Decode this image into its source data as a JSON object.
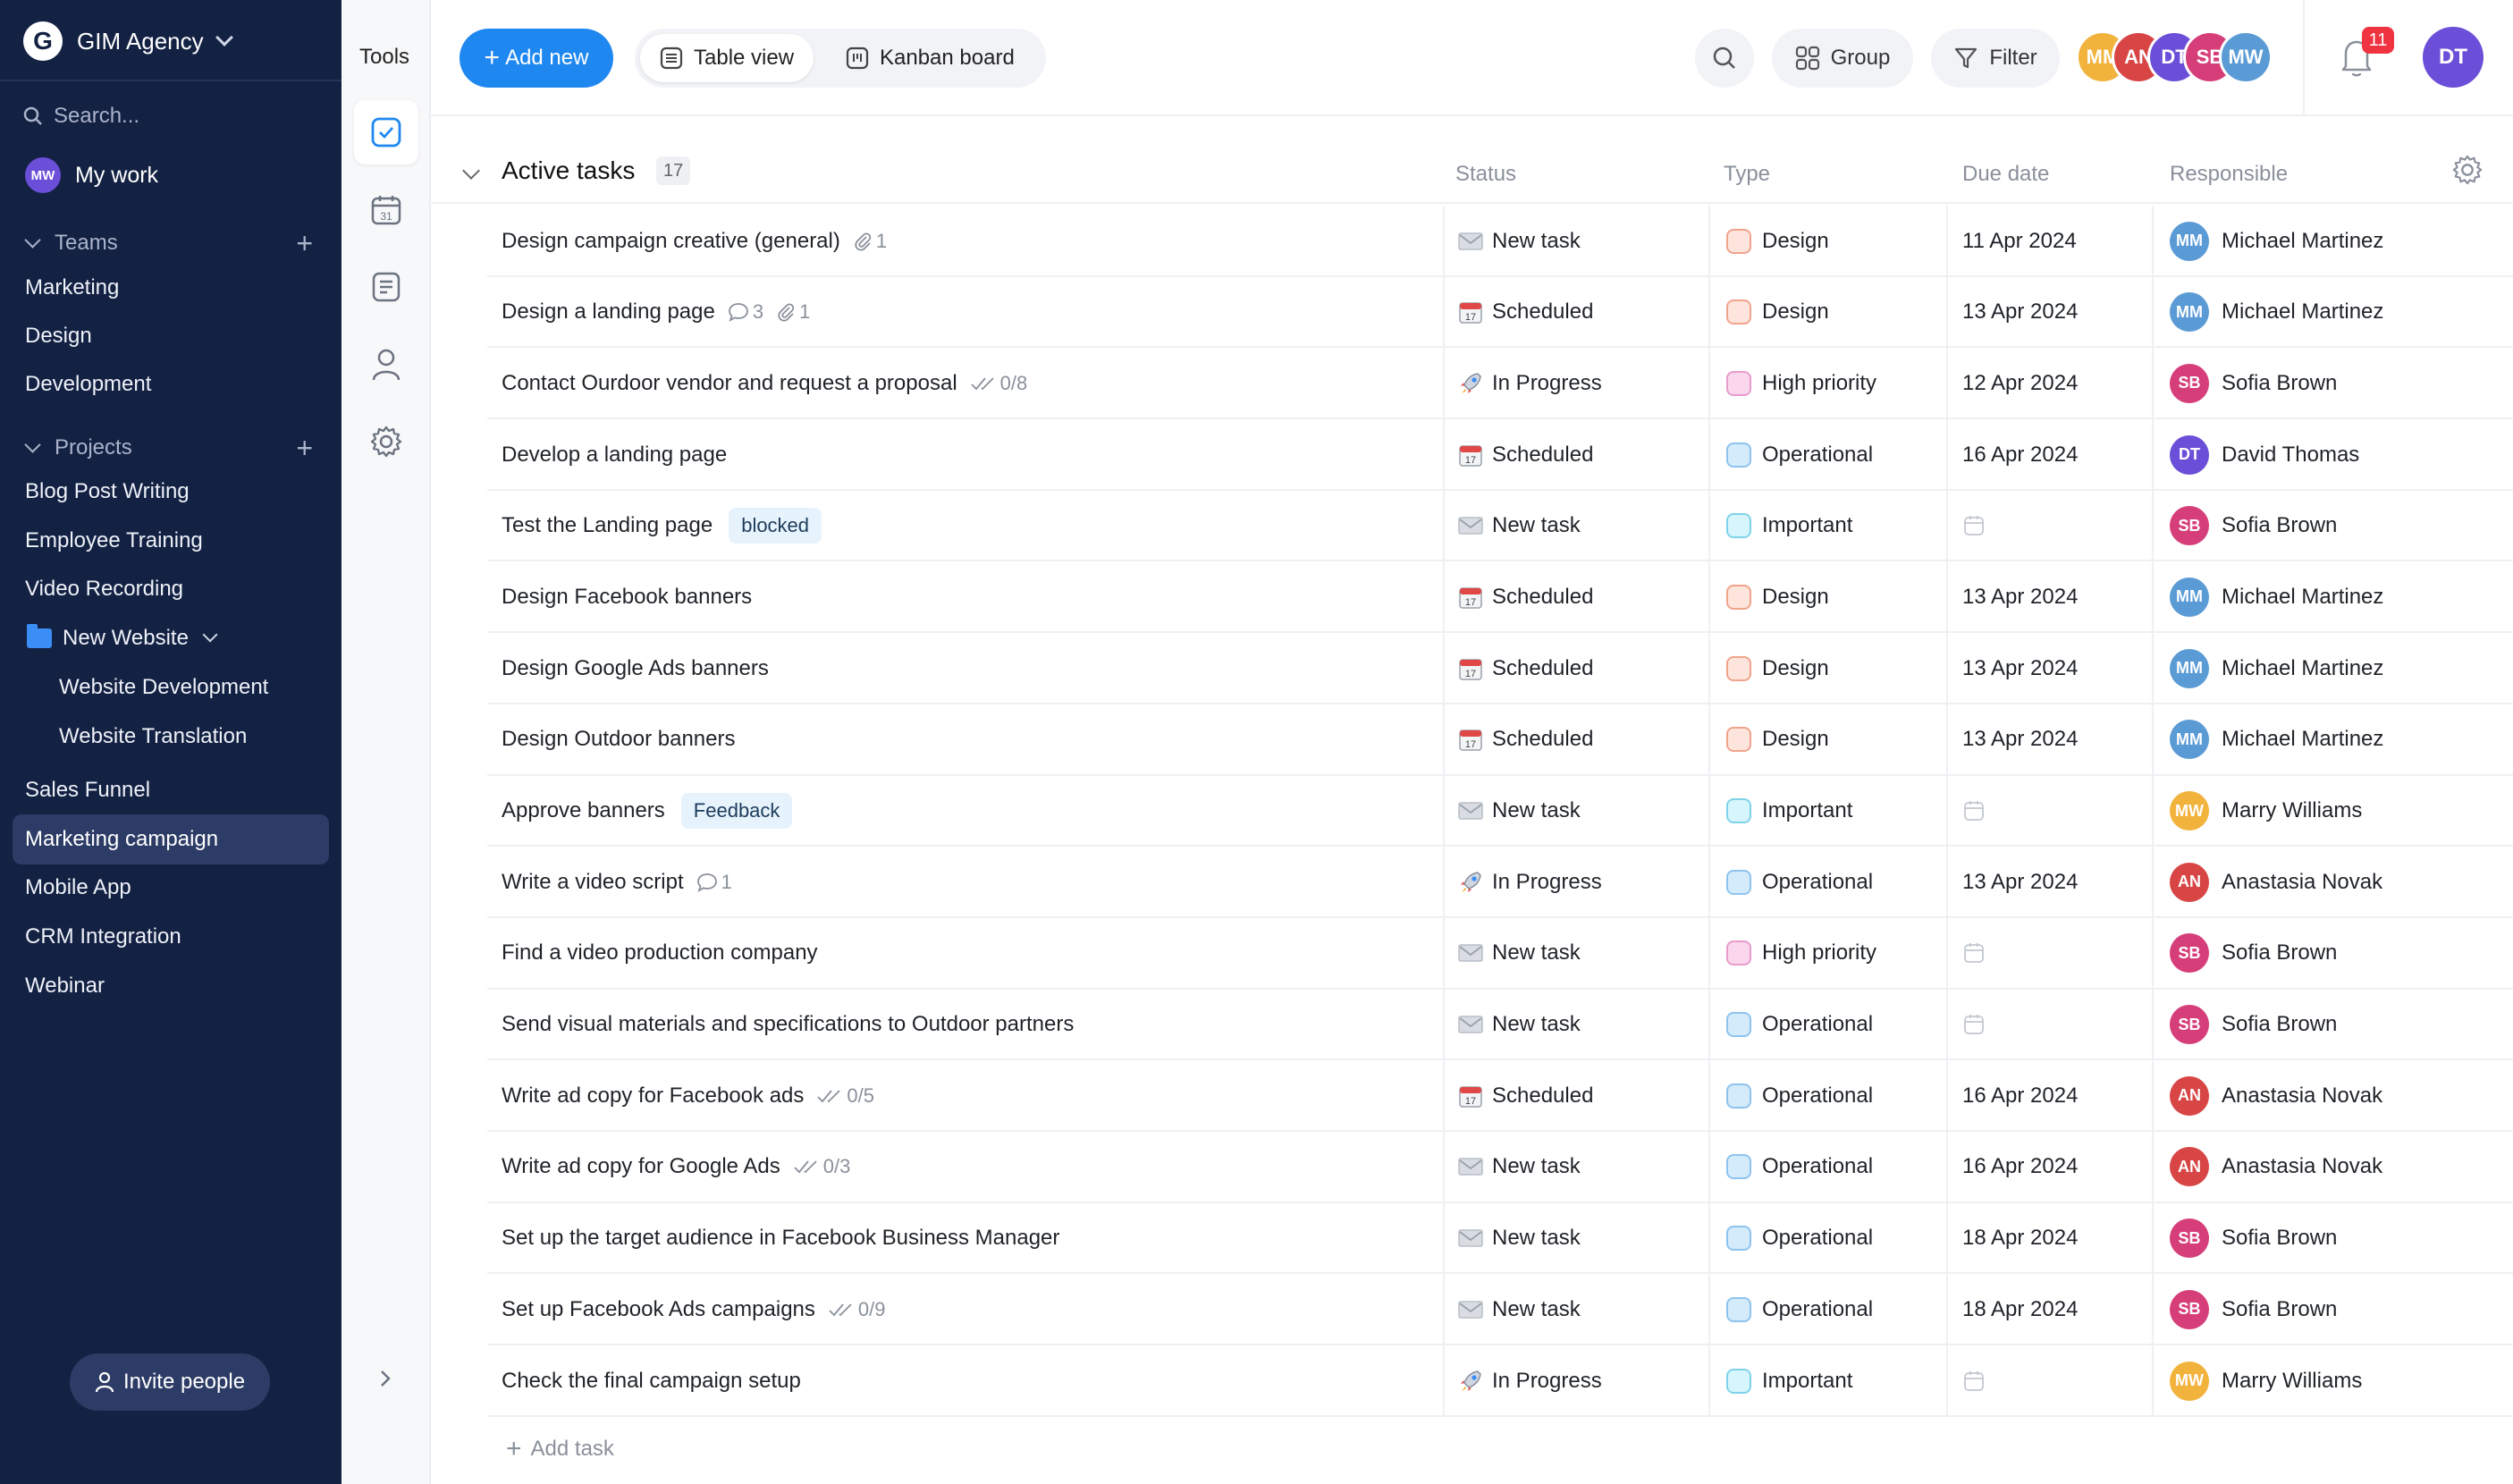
{
  "sidebar": {
    "workspace": {
      "logo_letter": "G",
      "name": "GIM Agency"
    },
    "search_placeholder": "Search...",
    "my_work": {
      "label": "My work",
      "avatar": "MW"
    },
    "teams": {
      "label": "Teams",
      "items": [
        "Marketing",
        "Design",
        "Development"
      ]
    },
    "projects": {
      "label": "Projects",
      "items": [
        "Blog Post Writing",
        "Employee Training",
        "Video Recording"
      ],
      "folder": {
        "label": "New Website",
        "children": [
          "Website Development",
          "Website Translation"
        ]
      },
      "items_after": [
        "Sales Funnel",
        "Marketing campaign",
        "Mobile App",
        "CRM Integration",
        "Webinar"
      ],
      "active": "Marketing campaign"
    },
    "invite_label": "Invite people"
  },
  "tools": {
    "title": "Tools",
    "icons": [
      "check-square-icon",
      "calendar-icon",
      "document-icon",
      "person-icon",
      "settings-icon"
    ],
    "calendar_day": "31"
  },
  "toolbar": {
    "add_new_label": "Add new",
    "views": [
      {
        "label": "Table view",
        "icon": "table-icon",
        "active": true
      },
      {
        "label": "Kanban board",
        "icon": "kanban-icon",
        "active": false
      }
    ],
    "group_label": "Group",
    "filter_label": "Filter",
    "notifications_count": "11",
    "avatars": [
      "MM",
      "AN",
      "DT",
      "SB",
      "MW"
    ]
  },
  "group": {
    "title": "Active tasks",
    "count": "17"
  },
  "columns": {
    "status": "Status",
    "type": "Type",
    "due": "Due date",
    "responsible": "Responsible"
  },
  "colors": {
    "accent": "#1f88f0",
    "sidebar_bg": "#132143",
    "badge": "#ef3340"
  },
  "type_colors": {
    "Design": {
      "bg": "#fde4dc",
      "border": "#f0a48c"
    },
    "High priority": {
      "bg": "#fbd7ee",
      "border": "#e79ccc"
    },
    "Operational": {
      "bg": "#d4ebfc",
      "border": "#8ec3ee"
    },
    "Important": {
      "bg": "#d6f5fc",
      "border": "#7fd3e8"
    }
  },
  "people": {
    "Michael Martinez": {
      "initials": "MM",
      "color": "#5b9bd5"
    },
    "Sofia Brown": {
      "initials": "SB",
      "color": "#d63e7a"
    },
    "David Thomas": {
      "initials": "DT",
      "color": "#6b4fd8"
    },
    "Marry Williams": {
      "initials": "MW",
      "color": "#f2b33d"
    },
    "Anastasia Novak": {
      "initials": "AN",
      "color": "#d84545"
    }
  },
  "status_icons": {
    "New task": "envelope-icon",
    "Scheduled": "calendar-icon",
    "In Progress": "rocket-icon"
  },
  "tasks": [
    {
      "name": "Design campaign creative (general)",
      "attachments": "1",
      "status": "New task",
      "type": "Design",
      "due": "11 Apr 2024",
      "responsible": "Michael Martinez"
    },
    {
      "name": "Design a landing page",
      "comments": "3",
      "attachments": "1",
      "status": "Scheduled",
      "type": "Design",
      "due": "13 Apr 2024",
      "responsible": "Michael Martinez"
    },
    {
      "name": "Contact Ourdoor vendor and request a proposal",
      "checklist": "0/8",
      "status": "In Progress",
      "type": "High priority",
      "due": "12 Apr 2024",
      "responsible": "Sofia Brown"
    },
    {
      "name": "Develop a landing page",
      "status": "Scheduled",
      "type": "Operational",
      "due": "16 Apr 2024",
      "responsible": "David Thomas"
    },
    {
      "name": "Test the Landing page",
      "tag": "blocked",
      "status": "New task",
      "type": "Important",
      "due": "",
      "responsible": "Sofia Brown"
    },
    {
      "name": "Design Facebook banners",
      "status": "Scheduled",
      "type": "Design",
      "due": "13 Apr 2024",
      "responsible": "Michael Martinez"
    },
    {
      "name": "Design Google Ads banners",
      "status": "Scheduled",
      "type": "Design",
      "due": "13 Apr 2024",
      "responsible": "Michael Martinez"
    },
    {
      "name": "Design Outdoor banners",
      "status": "Scheduled",
      "type": "Design",
      "due": "13 Apr 2024",
      "responsible": "Michael Martinez"
    },
    {
      "name": "Approve banners",
      "tag": "Feedback",
      "status": "New task",
      "type": "Important",
      "due": "",
      "responsible": "Marry Williams"
    },
    {
      "name": "Write a video script",
      "comments": "1",
      "status": "In Progress",
      "type": "Operational",
      "due": "13 Apr 2024",
      "responsible": "Anastasia Novak"
    },
    {
      "name": "Find a video production company",
      "status": "New task",
      "type": "High priority",
      "due": "",
      "responsible": "Sofia Brown"
    },
    {
      "name": "Send visual materials and specifications to Outdoor partners",
      "status": "New task",
      "type": "Operational",
      "due": "",
      "responsible": "Sofia Brown"
    },
    {
      "name": "Write ad copy for Facebook ads",
      "checklist": "0/5",
      "status": "Scheduled",
      "type": "Operational",
      "due": "16 Apr 2024",
      "responsible": "Anastasia Novak"
    },
    {
      "name": "Write ad copy for Google Ads",
      "checklist": "0/3",
      "status": "New task",
      "type": "Operational",
      "due": "16 Apr 2024",
      "responsible": "Anastasia Novak"
    },
    {
      "name": "Set up the target audience in Facebook Business Manager",
      "status": "New task",
      "type": "Operational",
      "due": "18 Apr 2024",
      "responsible": "Sofia Brown"
    },
    {
      "name": "Set up Facebook Ads campaigns",
      "checklist": "0/9",
      "status": "New task",
      "type": "Operational",
      "due": "18 Apr 2024",
      "responsible": "Sofia Brown"
    },
    {
      "name": "Check the final campaign setup",
      "status": "In Progress",
      "type": "Important",
      "due": "",
      "responsible": "Marry Williams"
    }
  ],
  "add_task_label": "Add task"
}
